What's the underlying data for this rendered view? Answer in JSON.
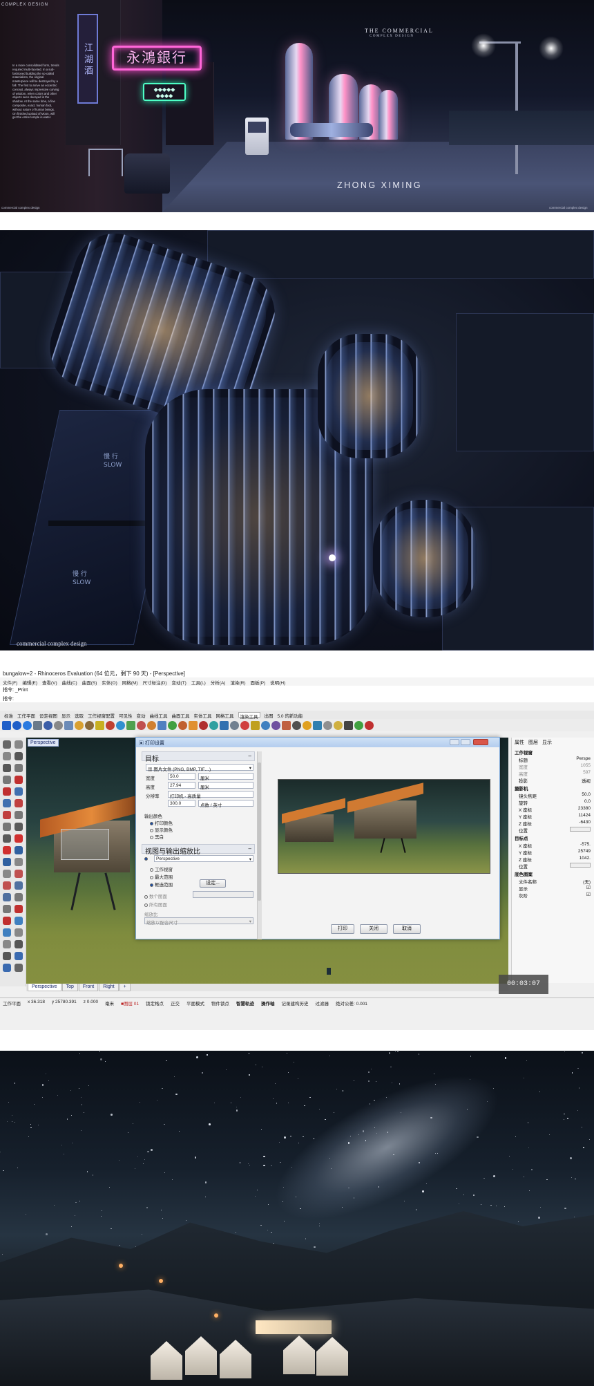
{
  "panel1": {
    "top_left_label": "COMPLEX DESIGN",
    "title_line1": "THE COMMERCIAL",
    "title_line2": "COMPLEX DESIGN",
    "author": "ZHONG XIMING",
    "neon_sign_pink": "永鴻銀行",
    "vertical_sign": "江 湖 酒",
    "paragraph": "In a more consolidated form, trends required multi-faceted. In a sub-fashioned building the so-called materialism, the original masterpiece will be destroyed by a fall. The first to arrive an eccentric concept, always impressive curving of wisdom, when colors and other objects seen decayed in the shadow. At the same time, a fine composite, exact, human foot, without nature of human beings. On finished upload of Moon, will get the entire temple is water.",
    "footer_left": "commercial complex design",
    "footer_right": "commercial complex design"
  },
  "panel2": {
    "caption": "commercial complex design",
    "street_texts": [
      "慢 行",
      "SLOW",
      "慢 行",
      "SLOW"
    ]
  },
  "rhino": {
    "window_title": "bungalow+2 - Rhinoceros Evaluation (64 位元，剩下 90 天) - [Perspective]",
    "menu": [
      "文件(F)",
      "编辑(E)",
      "查看(V)",
      "曲线(C)",
      "曲面(S)",
      "实体(O)",
      "网格(M)",
      "尺寸标注(D)",
      "变动(T)",
      "工具(L)",
      "分析(A)",
      "渲染(R)",
      "面板(P)",
      "说明(H)"
    ],
    "command_label": "指令:",
    "command_value": "_Print",
    "command_prompt": "指令:",
    "toolbar_tabs": [
      "标准",
      "工作平面",
      "设定视图",
      "显示",
      "选取",
      "工作视窗配置",
      "可见性",
      "变动",
      "曲线工具",
      "曲面工具",
      "实体工具",
      "网格工具",
      "渲染工具",
      "出图",
      "5.0 的新功能"
    ],
    "viewport_label": "Perspective",
    "dialog": {
      "title": "打印设置",
      "section_target": "目标",
      "printer_select": "图片文件 (PNG, BMP, TIF…)",
      "width_label": "宽度",
      "width_value": "50.0",
      "width_unit": "厘米",
      "height_label": "高度",
      "height_value": "27.94",
      "height_unit": "厘米",
      "resolution_label": "分辨率",
      "resolution_preset": "打印机 - 高质量",
      "resolution_value": "300.0",
      "resolution_unit": "点数 / 英寸",
      "output_color_label": "输出颜色",
      "color_options": [
        "打印颜色",
        "显示颜色",
        "黑白"
      ],
      "section_view": "视图与输出缩放比",
      "view_select": "Perspective",
      "view_options": [
        "工作视窗",
        "最大范围",
        "框选范围"
      ],
      "set_button": "设定...",
      "multi_page": "数个图面",
      "all_pages": "所有图面",
      "scale_label": "缩放比",
      "scale_select": "缩放以配合尺寸",
      "print_button": "打印",
      "close_button": "关闭",
      "cancel_button": "取消"
    },
    "right_panel": {
      "tabs": [
        "属性",
        "图层",
        "显示"
      ],
      "section_viewport": "工作视窗",
      "title_label": "标题",
      "title_value": "Perspe",
      "width_label": "宽度",
      "width_value": "1055",
      "height_label": "高度",
      "height_value": "597",
      "projection_label": "投影",
      "projection_value": "透视",
      "section_camera": "摄影机",
      "lens_label": "镜头焦距",
      "lens_value": "50.0",
      "rotate_label": "旋转",
      "rotate_value": "0.0",
      "xpos_label": "X 座标",
      "xpos_value": "23380",
      "ypos_label": "Y 座标",
      "ypos_value": "11424",
      "zpos_label": "Z 座标",
      "zpos_value": "-6430",
      "location_label": "位置",
      "section_target": "目标点",
      "tx_label": "X 座标",
      "tx_value": "-575.",
      "ty_label": "Y 座标",
      "ty_value": "25749",
      "tz_label": "Z 座标",
      "tz_value": "1042.",
      "tloc_label": "位置",
      "section_bg": "底色图案",
      "file_label": "文件名称",
      "file_value": "(无)",
      "show_label": "显示",
      "gray_label": "灰阶"
    },
    "viewport_tabs": [
      "Perspective",
      "Top",
      "Front",
      "Right",
      "+"
    ],
    "status": {
      "plane": "工作平面",
      "x": "x 36.318",
      "y": "y 25780.391",
      "z": "z 0.000",
      "unit": "毫米",
      "layer": "■图层 01",
      "items": [
        "锁定格点",
        "正交",
        "平面模式",
        "物件锁点",
        "智慧轨迹",
        "操作轴",
        "记录建构历史",
        "过滤器",
        "绝对公差: 0.001"
      ]
    },
    "timer": "00:03:07"
  },
  "colors": {
    "neon_pink": "#ff66d9",
    "neon_green": "#4effc6",
    "rhino_dialog_border": "#7aa6d8"
  }
}
